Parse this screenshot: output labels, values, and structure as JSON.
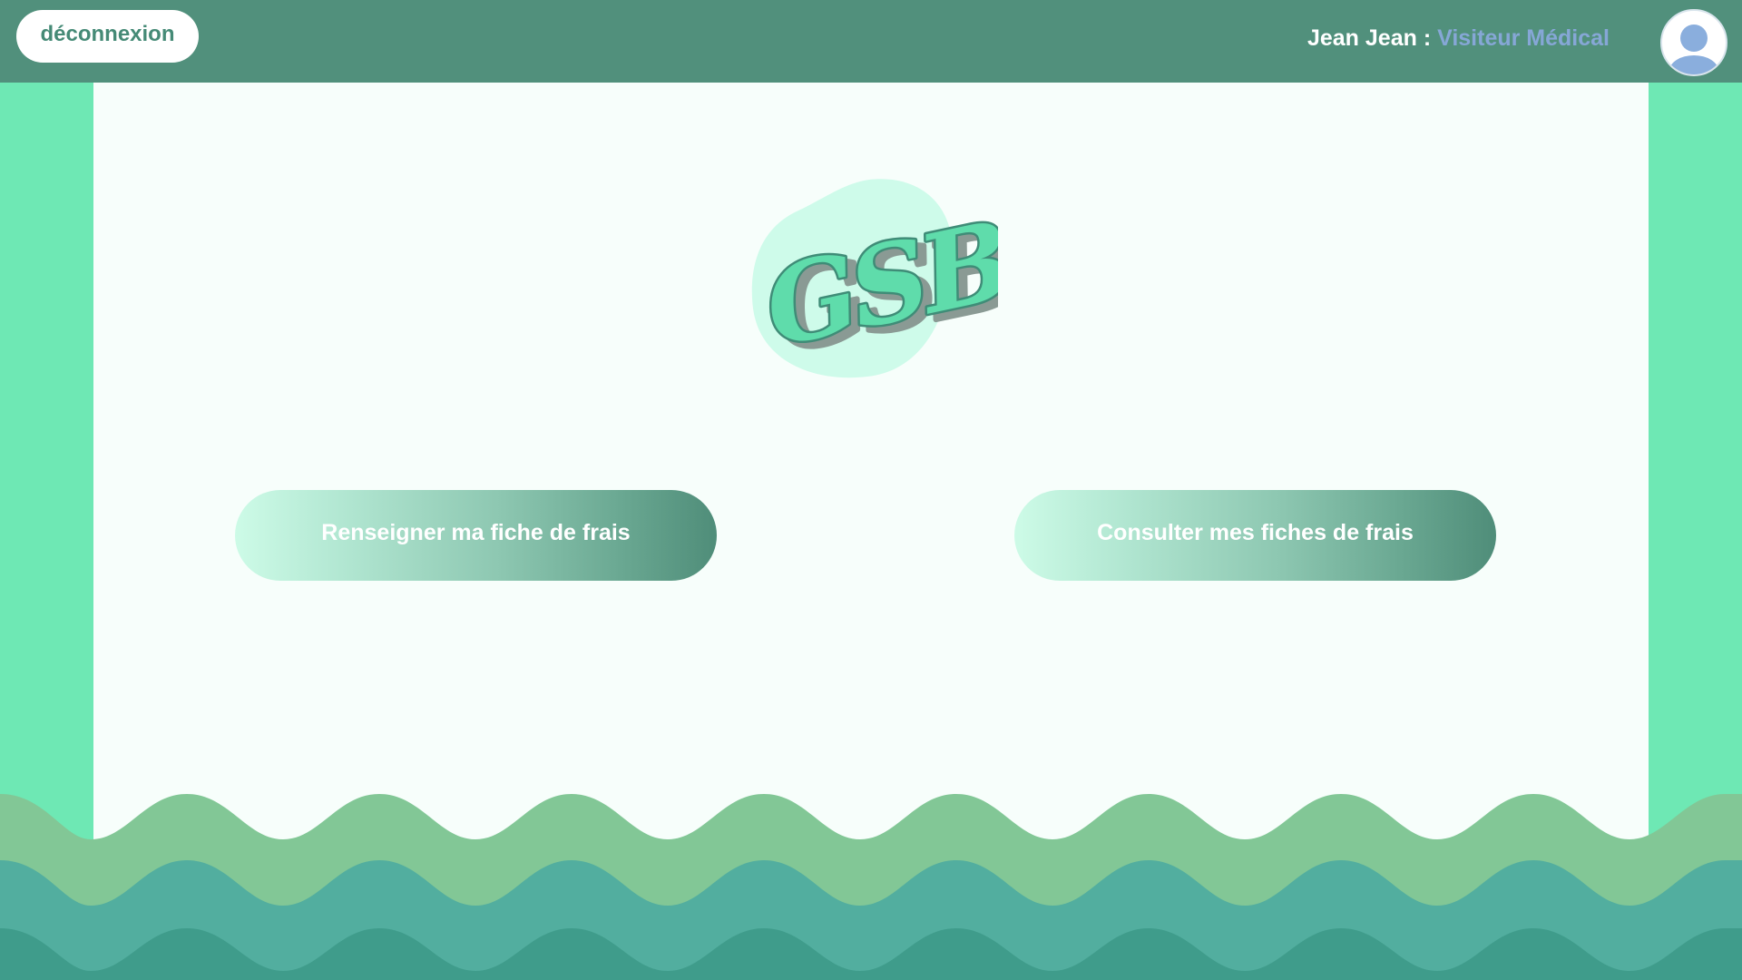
{
  "header": {
    "logout_label": "déconnexion",
    "user_name": "Jean Jean",
    "separator": " : ",
    "user_role": "Visiteur Médical",
    "avatar_icon": "user-avatar-icon"
  },
  "logo": {
    "text": "GSB",
    "icon": "gsb-logo"
  },
  "actions": {
    "fill_form_label": "Renseigner ma fiche de frais",
    "view_forms_label": "Consulter mes fiches de frais"
  },
  "colors": {
    "header": "#51907c",
    "side_bands": "#6ee8b4",
    "panel": "#f7fefb",
    "role_text": "#86a7d6",
    "wave_light": "#82c796",
    "wave_mid": "#52ae9f",
    "wave_dark": "#3f9c8b"
  }
}
